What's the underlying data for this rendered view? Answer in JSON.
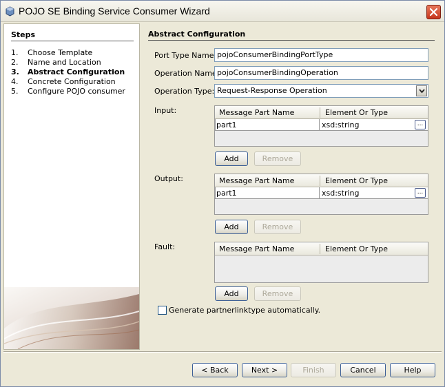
{
  "window": {
    "title": "POJO SE Binding Service Consumer Wizard"
  },
  "steps": {
    "heading": "Steps",
    "items": [
      {
        "num": "1.",
        "label": "Choose Template",
        "current": false
      },
      {
        "num": "2.",
        "label": "Name and Location",
        "current": false
      },
      {
        "num": "3.",
        "label": "Abstract Configuration",
        "current": true
      },
      {
        "num": "4.",
        "label": "Concrete Configuration",
        "current": false
      },
      {
        "num": "5.",
        "label": "Configure POJO consumer",
        "current": false
      }
    ]
  },
  "main": {
    "section_title": "Abstract Configuration",
    "port_type": {
      "label": "Port Type Name:",
      "value": "pojoConsumerBindingPortType"
    },
    "operation_name": {
      "label": "Operation Name:",
      "value": "pojoConsumerBindingOperation"
    },
    "operation_type": {
      "label": "Operation Type:",
      "value": "Request-Response Operation"
    },
    "table_headers": {
      "col1": "Message Part Name",
      "col2": "Element Or Type"
    },
    "input": {
      "label": "Input:",
      "rows": [
        {
          "part": "part1",
          "type": "xsd:string"
        }
      ],
      "add_label": "Add",
      "remove_label": "Remove"
    },
    "output": {
      "label": "Output:",
      "rows": [
        {
          "part": "part1",
          "type": "xsd:string"
        }
      ],
      "add_label": "Add",
      "remove_label": "Remove"
    },
    "fault": {
      "label": "Fault:",
      "rows": [],
      "add_label": "Add",
      "remove_label": "Remove"
    },
    "ellipsis": "...",
    "auto_partnerlink": {
      "label": "Generate partnerlinktype automatically.",
      "checked": false
    }
  },
  "footer": {
    "back": "< Back",
    "next": "Next >",
    "finish": "Finish",
    "cancel": "Cancel",
    "help": "Help"
  },
  "icons": {
    "title": "app-icon",
    "close": "close-icon",
    "dropdown": "chevron-down-icon"
  },
  "colors": {
    "window_bg": "#ece9d8",
    "close_red": "#c6351c",
    "field_border": "#7f9db9"
  }
}
